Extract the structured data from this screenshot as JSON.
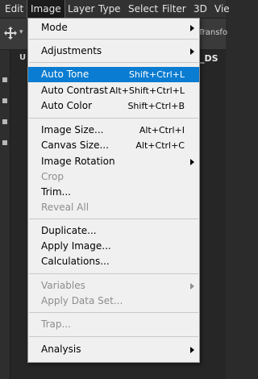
{
  "menubar": {
    "items": [
      {
        "label": "Edit"
      },
      {
        "label": "Image"
      },
      {
        "label": "Layer"
      },
      {
        "label": "Type"
      },
      {
        "label": "Select"
      },
      {
        "label": "Filter"
      },
      {
        "label": "3D"
      },
      {
        "label": "Vie"
      }
    ]
  },
  "options_bar": {
    "transform_label": "Transfo"
  },
  "document": {
    "tab_left": "U",
    "tab_right": "_DS",
    "close_glyph": "©"
  },
  "image_menu": {
    "items": [
      {
        "label": "Mode",
        "submenu": true
      },
      {
        "label": "Adjustments",
        "submenu": true
      },
      {
        "label": "Auto Tone",
        "shortcut": "Shift+Ctrl+L",
        "highlighted": true
      },
      {
        "label": "Auto Contrast",
        "shortcut": "Alt+Shift+Ctrl+L"
      },
      {
        "label": "Auto Color",
        "shortcut": "Shift+Ctrl+B"
      },
      {
        "label": "Image Size...",
        "shortcut": "Alt+Ctrl+I"
      },
      {
        "label": "Canvas Size...",
        "shortcut": "Alt+Ctrl+C"
      },
      {
        "label": "Image Rotation",
        "submenu": true
      },
      {
        "label": "Crop",
        "disabled": true
      },
      {
        "label": "Trim..."
      },
      {
        "label": "Reveal All",
        "disabled": true
      },
      {
        "label": "Duplicate..."
      },
      {
        "label": "Apply Image..."
      },
      {
        "label": "Calculations..."
      },
      {
        "label": "Variables",
        "submenu": true,
        "disabled": true
      },
      {
        "label": "Apply Data Set...",
        "disabled": true
      },
      {
        "label": "Trap...",
        "disabled": true
      },
      {
        "label": "Analysis",
        "submenu": true
      }
    ]
  },
  "colors": {
    "highlight": "#0a7cd1",
    "menu_bg": "#f0f0f0",
    "disabled_text": "#8d8d8d",
    "app_bg": "#2b2b2b"
  }
}
